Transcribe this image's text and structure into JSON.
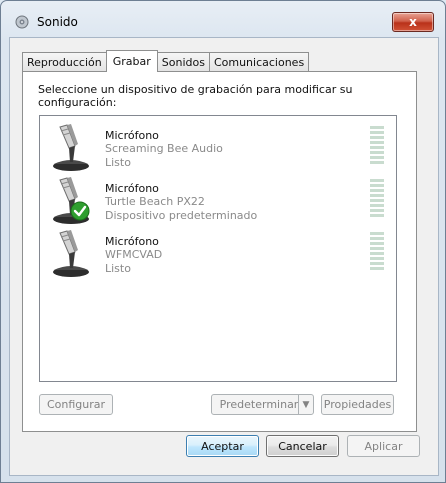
{
  "window": {
    "title": "Sonido",
    "close_label": "x"
  },
  "tabs": [
    {
      "label": "Reproducción",
      "active": false
    },
    {
      "label": "Grabar",
      "active": true
    },
    {
      "label": "Sonidos",
      "active": false
    },
    {
      "label": "Comunicaciones",
      "active": false
    }
  ],
  "panel": {
    "instruction": "Seleccione un dispositivo de grabación para modificar su configuración:"
  },
  "devices": [
    {
      "name": "Micrófono",
      "detail": "Screaming Bee Audio",
      "status": "Listo",
      "default": false
    },
    {
      "name": "Micrófono",
      "detail": "Turtle Beach PX22",
      "status": "Dispositivo predeterminado",
      "default": true
    },
    {
      "name": "Micrófono",
      "detail": "WFMCVAD",
      "status": "Listo",
      "default": false
    }
  ],
  "panel_buttons": {
    "configure": "Configurar",
    "set_default": "Predeterminar",
    "properties": "Propiedades"
  },
  "dialog_buttons": {
    "accept": "Aceptar",
    "cancel": "Cancelar",
    "apply": "Aplicar"
  },
  "colors": {
    "default_check": "#2f9e2f",
    "meter_idle": "#c9dccf"
  },
  "icons": {
    "app": "speaker-icon",
    "device": "microphone-icon",
    "default_badge": "green-check-icon",
    "dropdown": "chevron-down-icon"
  }
}
